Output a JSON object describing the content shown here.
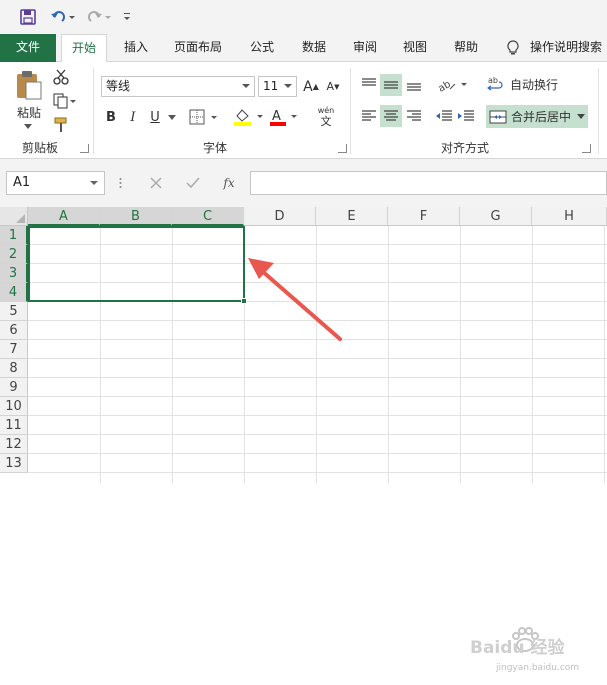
{
  "quick_access": {
    "save_icon": "save-icon",
    "undo_icon": "undo-icon",
    "redo_icon": "redo-icon",
    "customize_icon": "customize-qat-icon"
  },
  "tabs": [
    {
      "label": "文件"
    },
    {
      "label": "开始"
    },
    {
      "label": "插入"
    },
    {
      "label": "页面布局"
    },
    {
      "label": "公式"
    },
    {
      "label": "数据"
    },
    {
      "label": "审阅"
    },
    {
      "label": "视图"
    },
    {
      "label": "帮助"
    }
  ],
  "tell_me": "操作说明搜索",
  "clipboard": {
    "paste_label": "粘贴",
    "group_label": "剪贴板"
  },
  "font": {
    "name": "等线",
    "size": "11",
    "group_label": "字体",
    "bold": "B",
    "italic": "I",
    "underline": "U",
    "increase": "A",
    "decrease": "A",
    "wen": "wén",
    "wen_char": "文"
  },
  "alignment": {
    "wrap_label": "自动换行",
    "merge_label": "合并后居中",
    "group_label": "对齐方式"
  },
  "formula_bar": {
    "name_box": "A1",
    "fx": "fx",
    "formula": ""
  },
  "columns": [
    "A",
    "B",
    "C",
    "D",
    "E",
    "F",
    "G",
    "H"
  ],
  "rows": [
    "1",
    "2",
    "3",
    "4",
    "5",
    "6",
    "7",
    "8",
    "9",
    "10",
    "11",
    "12",
    "13"
  ],
  "watermark": {
    "brand": "Baidu 经验",
    "url": "jingyan.baidu.com"
  },
  "colors": {
    "accent": "#217346",
    "arrow": "#e8584f",
    "fill_yellow": "#ffff00",
    "font_red": "#ff0000"
  }
}
